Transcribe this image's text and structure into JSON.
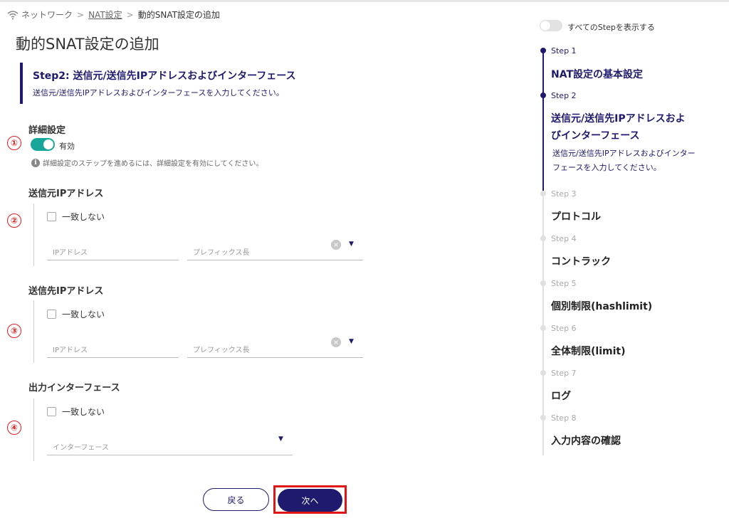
{
  "breadcrumb": {
    "items": [
      "ネットワーク",
      "NAT設定"
    ],
    "current": "動的SNAT設定の追加"
  },
  "page_title": "動的SNAT設定の追加",
  "step_header": {
    "title": "Step2: 送信元/送信先IPアドレスおよびインターフェース",
    "description": "送信元/送信先IPアドレスおよびインターフェースを入力してください。"
  },
  "annotations": [
    "①",
    "②",
    "③",
    "④"
  ],
  "advanced": {
    "label": "詳細設定",
    "toggle_label": "有効",
    "toggle_on": true,
    "info": "詳細設定のステップを進めるには、詳細設定を有効にしてください。"
  },
  "source_ip": {
    "label": "送信元IPアドレス",
    "not_match": "一致しない",
    "ip_placeholder": "IPアドレス",
    "prefix_placeholder": "プレフィックス長"
  },
  "dest_ip": {
    "label": "送信先IPアドレス",
    "not_match": "一致しない",
    "ip_placeholder": "IPアドレス",
    "prefix_placeholder": "プレフィックス長"
  },
  "out_iface": {
    "label": "出力インターフェース",
    "not_match": "一致しない",
    "placeholder": "インターフェース"
  },
  "buttons": {
    "back": "戻る",
    "next": "次へ"
  },
  "stepper": {
    "show_all": "すべてのStepを表示する",
    "steps": [
      {
        "num": "Step 1",
        "name": "NAT設定の基本設定"
      },
      {
        "num": "Step 2",
        "name_line1": "送信元/送信先IPアドレスおよ",
        "name_line2": "びインターフェース",
        "desc": "送信元/送信先IPアドレスおよびインターフェースを入力してください。"
      },
      {
        "num": "Step 3",
        "name": "プロトコル"
      },
      {
        "num": "Step 4",
        "name": "コントラック"
      },
      {
        "num": "Step 5",
        "name": "個別制限(hashlimit)"
      },
      {
        "num": "Step 6",
        "name": "全体制限(limit)"
      },
      {
        "num": "Step 7",
        "name": "ログ"
      },
      {
        "num": "Step 8",
        "name": "入力内容の確認"
      }
    ]
  },
  "colors": {
    "primary": "#1e1a6e",
    "toggle": "#17a79a",
    "annotation": "#d62020"
  }
}
